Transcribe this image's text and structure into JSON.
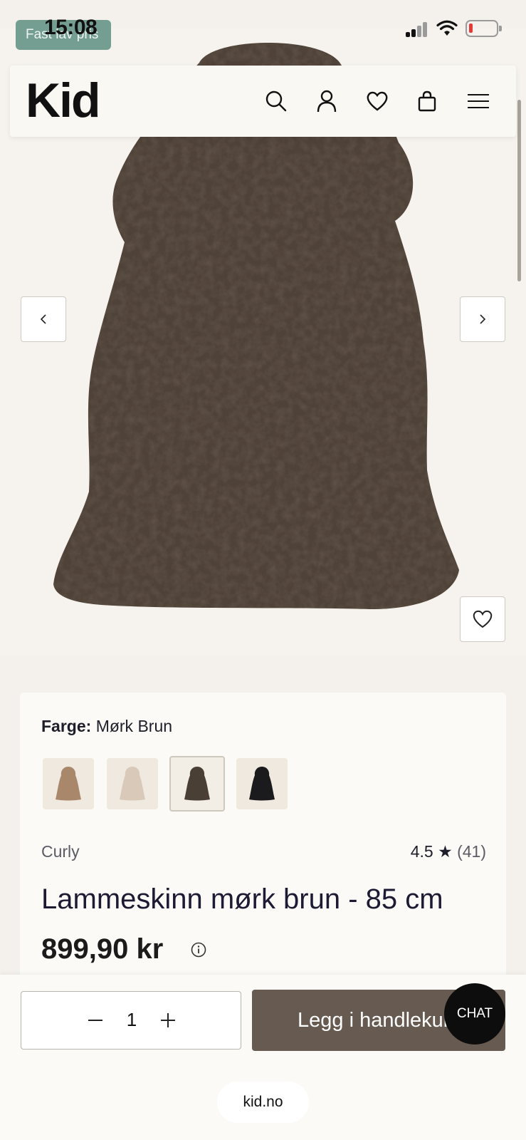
{
  "status_bar": {
    "time": "15:08",
    "promo_badge": "Fast lav pris"
  },
  "header": {
    "logo": "Kid",
    "icons": [
      "search-icon",
      "account-icon",
      "heart-icon",
      "bag-icon",
      "menu-icon"
    ]
  },
  "product": {
    "color_label": "Farge:",
    "color_value": "Mørk Brun",
    "swatches": [
      {
        "name": "beige",
        "color": "#a9876b"
      },
      {
        "name": "cream",
        "color": "#d8c9b8"
      },
      {
        "name": "dark-brown",
        "color": "#4a3f35",
        "selected": true
      },
      {
        "name": "black",
        "color": "#1b1b1e"
      }
    ],
    "brand": "Curly",
    "rating": "4.5 ★",
    "rating_count": "(41)",
    "title": "Lammeskinn mørk brun - 85 cm",
    "price": "899,90 kr"
  },
  "purchase": {
    "quantity": "1",
    "add_to_cart": "Legg i handlekurv",
    "chat": "CHAT"
  },
  "browser": {
    "url": "kid.no"
  },
  "colors": {
    "page_bg": "#f4f1ec",
    "card_bg": "#fbfaf6",
    "button_bg": "#665a51",
    "pelt": "#4f4339"
  }
}
